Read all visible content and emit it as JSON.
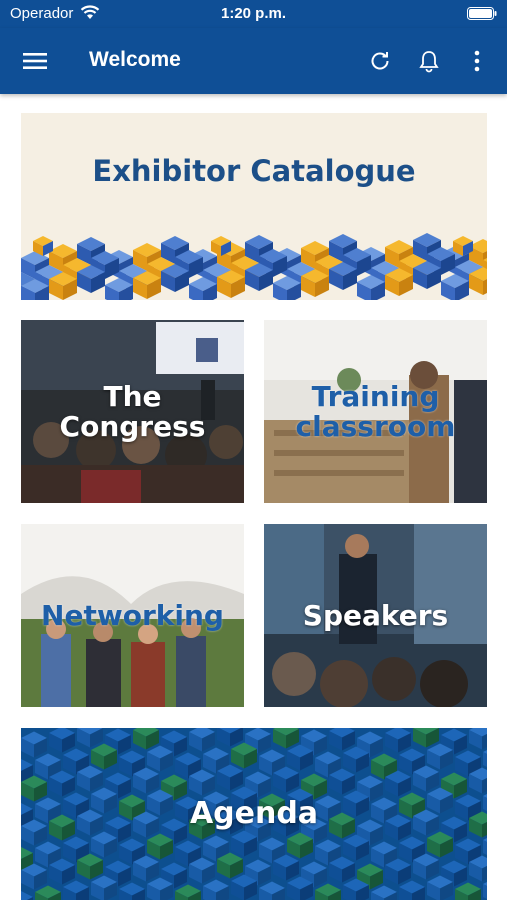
{
  "status_bar": {
    "carrier": "Operador",
    "time": "1:20 p.m."
  },
  "app_bar": {
    "title": "Welcome",
    "icons": [
      "menu-icon",
      "refresh-icon",
      "bell-icon",
      "more-vert-icon"
    ]
  },
  "colors": {
    "primary": "#0f4f96",
    "hero_bg": "#f5efe3",
    "hero_text": "#1c4f88",
    "accent_yellow": "#f5b82e"
  },
  "tiles": {
    "exhibitor": "Exhibitor Catalogue",
    "congress": "The Congress",
    "training": "Training classroom",
    "networking": "Networking",
    "speakers": "Speakers",
    "agenda": "Agenda"
  }
}
